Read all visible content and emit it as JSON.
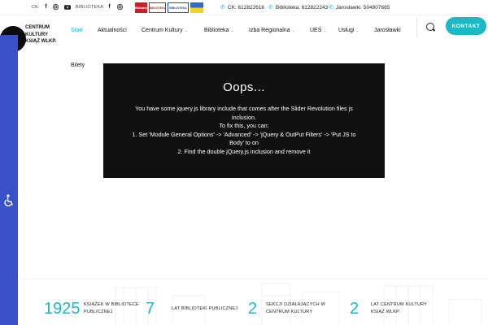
{
  "topbar": {
    "ck_label": "CK:",
    "library_label": "BIBLIOTEKA:",
    "logos": [
      "Bibliotek",
      "BIBLIOTEKA",
      "BIBLIOTEKA",
      ""
    ],
    "phones": [
      {
        "label": "CK: 612822616"
      },
      {
        "label": "Biblioteka: 612822243"
      },
      {
        "label": "Jarosławki: 504807685"
      }
    ]
  },
  "brand": {
    "line1": "CENTRUM",
    "line2": "KULTURY",
    "line3": "KSIĄŻ WLKP."
  },
  "nav": {
    "items": [
      {
        "label": "Start",
        "active": true
      },
      {
        "label": "Aktualności"
      },
      {
        "label": "Centrum Kultury"
      },
      {
        "label": "Biblioteka"
      },
      {
        "label": "Izba Regionalna"
      },
      {
        "label": "UEŚ"
      },
      {
        "label": "Usługi"
      },
      {
        "label": "Jarosławki"
      }
    ],
    "second_row": "Bilety",
    "contact_button": "KONTAKT"
  },
  "error": {
    "title": "Oops...",
    "line1": "You have some jquery.js library include that comes after the Slider Revolution files js",
    "line2": "inclusion.",
    "line3": "To fix this, you can:",
    "line4": "1. Set 'Module General Options' -> 'Advanced' -> 'jQuery & OutPut Filters' -> 'Put JS to",
    "line5": "Body' to on",
    "line6": "2. Find the double jQuery.js inclusion and remove it"
  },
  "stats": [
    {
      "number": "1925",
      "label1": "KSIĄŻEK W BIBLIOTECE",
      "label2": "PUBLICZNEJ"
    },
    {
      "number": "7",
      "label1": "LAT BIBLIOTEKI PUBLICZNEJ",
      "label2": ""
    },
    {
      "number": "2",
      "label1": "SEKCJI DZIAŁAJĄCYCH W",
      "label2": "CENTRUM KULTURY"
    },
    {
      "number": "2",
      "label1": "LAT CENTRUM KULTURY",
      "label2": "KSIĄŻ WLKP."
    }
  ],
  "colors": {
    "accent": "#1ab9c5",
    "side_bar": "#3a50c9",
    "error_bg": "#111111"
  },
  "icons": [
    "facebook-icon",
    "instagram-icon",
    "youtube-icon",
    "phone-icon",
    "search-icon",
    "accessibility-icon"
  ]
}
